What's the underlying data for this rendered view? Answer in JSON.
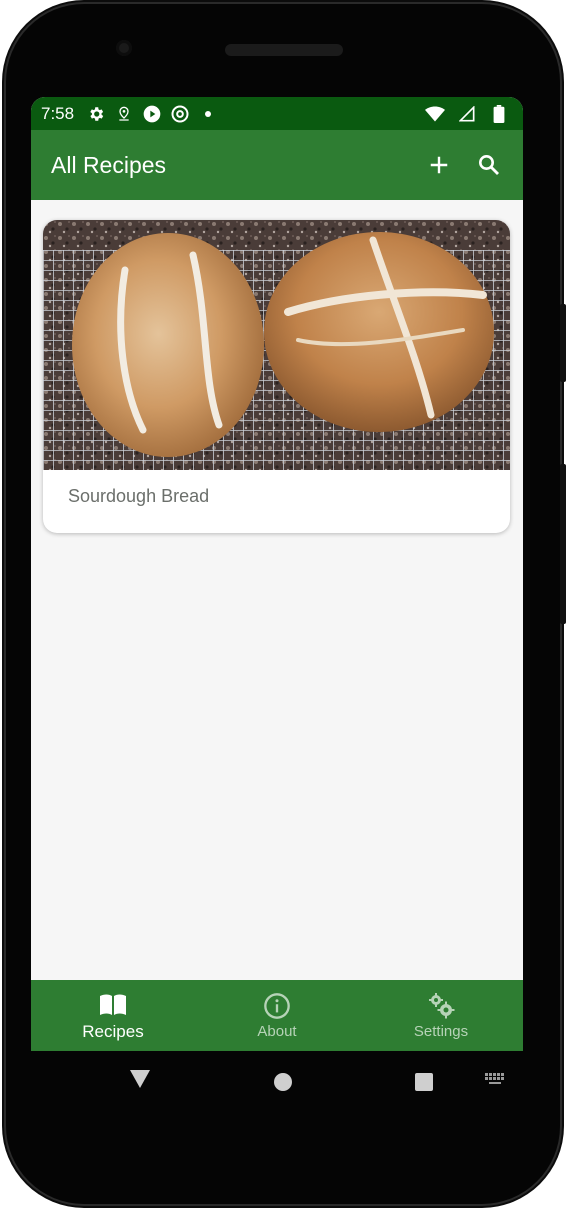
{
  "status_bar": {
    "time": "7:58",
    "left_icons": [
      "gear-icon",
      "location-pin-icon",
      "play-circle-icon",
      "at-sign-icon",
      "dot-icon"
    ],
    "right_icons": [
      "wifi-icon",
      "cell-signal-icon",
      "battery-icon"
    ]
  },
  "app_bar": {
    "title": "All Recipes",
    "actions": [
      "add-icon",
      "search-icon"
    ]
  },
  "recipes": [
    {
      "title": "Sourdough Bread",
      "image": "bread-photo"
    }
  ],
  "bottom_nav": {
    "items": [
      {
        "label": "Recipes",
        "icon": "book-icon",
        "active": true
      },
      {
        "label": "About",
        "icon": "info-icon",
        "active": false
      },
      {
        "label": "Settings",
        "icon": "gears-icon",
        "active": false
      }
    ]
  },
  "system_nav": [
    "back-triangle-icon",
    "home-circle-icon",
    "recents-square-icon",
    "keyboard-icon"
  ],
  "colors": {
    "primary": "#2e7d32",
    "status_bar": "#0a5a10",
    "background": "#f6f6f6",
    "card_text": "#6b6f6b",
    "inactive_nav": "#b6d3b7"
  }
}
